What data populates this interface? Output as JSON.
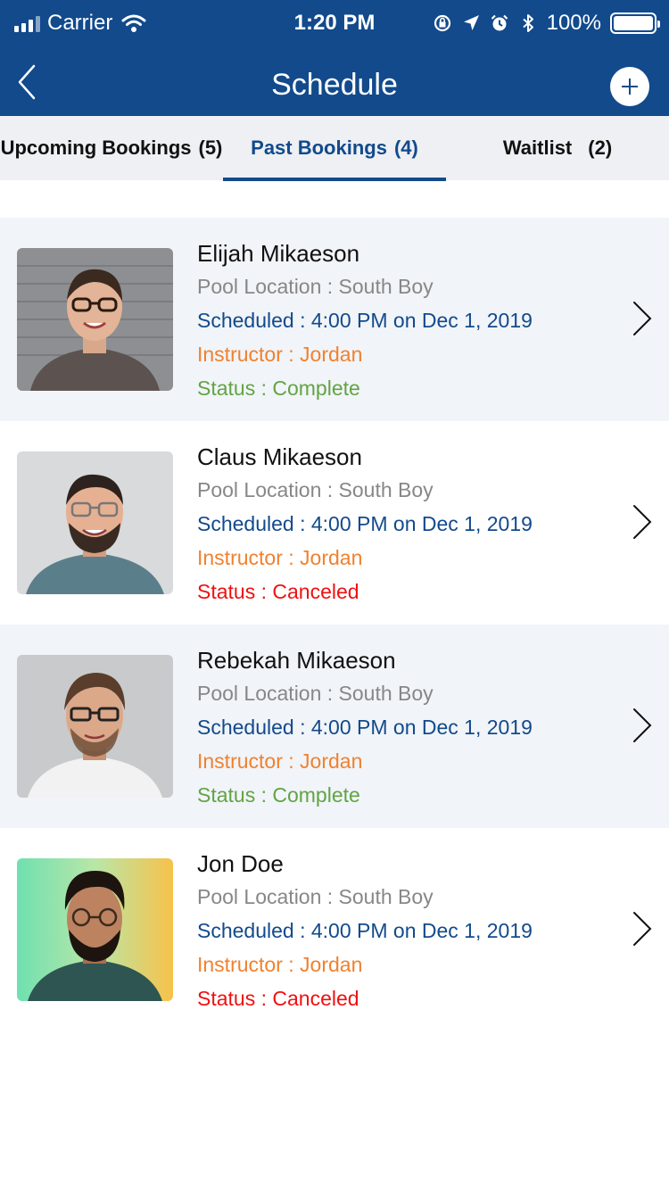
{
  "status_bar": {
    "carrier": "Carrier",
    "time": "1:20 PM",
    "battery": "100%"
  },
  "header": {
    "title": "Schedule"
  },
  "tabs": [
    {
      "label": "Upcoming Bookings",
      "count": "(5)"
    },
    {
      "label": "Past Bookings",
      "count": "(4)"
    },
    {
      "label": "Waitlist",
      "count": "(2)"
    }
  ],
  "colors": {
    "brand": "#124a8c",
    "location": "#878787",
    "instructor": "#f0812f",
    "complete": "#62a444",
    "canceled": "#ee1111"
  },
  "bookings": [
    {
      "name": "Elijah Mikaeson",
      "location": "Pool Location : South Boy",
      "scheduled": "Scheduled : 4:00 PM on Dec 1, 2019",
      "instructor": "Instructor : Jordan",
      "status": "Status : Complete"
    },
    {
      "name": "Claus Mikaeson",
      "location": "Pool Location : South Boy",
      "scheduled": "Scheduled : 4:00 PM on Dec 1, 2019",
      "instructor": "Instructor : Jordan",
      "status": "Status : Canceled"
    },
    {
      "name": "Rebekah Mikaeson",
      "location": "Pool Location : South Boy",
      "scheduled": "Scheduled : 4:00 PM on Dec 1, 2019",
      "instructor": "Instructor : Jordan",
      "status": "Status : Complete"
    },
    {
      "name": "Jon Doe",
      "location": "Pool Location : South Boy",
      "scheduled": "Scheduled : 4:00 PM on Dec 1, 2019",
      "instructor": "Instructor : Jordan",
      "status": "Status : Canceled"
    }
  ]
}
